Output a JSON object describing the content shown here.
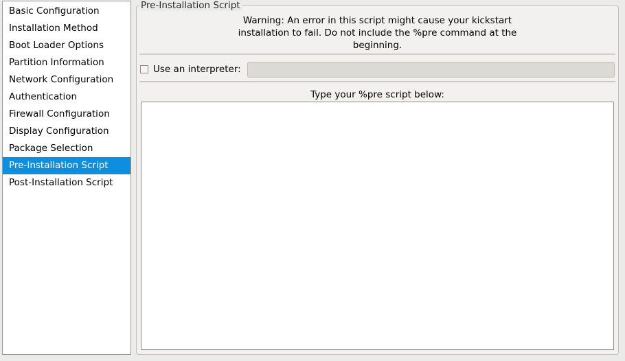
{
  "window": {
    "background_color": "#ebebe9"
  },
  "sidebar": {
    "name": "configuration-section-list",
    "items": [
      {
        "label": "Basic Configuration",
        "selected": false
      },
      {
        "label": "Installation Method",
        "selected": false
      },
      {
        "label": "Boot Loader Options",
        "selected": false
      },
      {
        "label": "Partition Information",
        "selected": false
      },
      {
        "label": "Network Configuration",
        "selected": false
      },
      {
        "label": "Authentication",
        "selected": false
      },
      {
        "label": "Firewall Configuration",
        "selected": false
      },
      {
        "label": "Display Configuration",
        "selected": false
      },
      {
        "label": "Package Selection",
        "selected": false
      },
      {
        "label": "Pre-Installation Script",
        "selected": true
      },
      {
        "label": "Post-Installation Script",
        "selected": false
      }
    ],
    "selected_label": "Pre-Installation Script",
    "selection_color": "#0d8ede",
    "selection_text_color": "#ffffff"
  },
  "main": {
    "group_title": "Pre-Installation Script",
    "warning": {
      "line1": "Warning: An error in this script might cause your kickstart",
      "line2": "installation to fail. Do not include the %pre command at the",
      "line3": "beginning.",
      "full_text": "Warning: An error in this script might cause your kickstart installation to fail. Do not include the %pre command at the beginning."
    },
    "interpreter": {
      "checkbox_label": "Use an interpreter:",
      "checked": false,
      "input_value": "",
      "input_placeholder": "",
      "input_enabled": false,
      "input_background": "#dcdad5"
    },
    "script": {
      "label": "Type your %pre script below:",
      "value": "",
      "placeholder": ""
    }
  }
}
